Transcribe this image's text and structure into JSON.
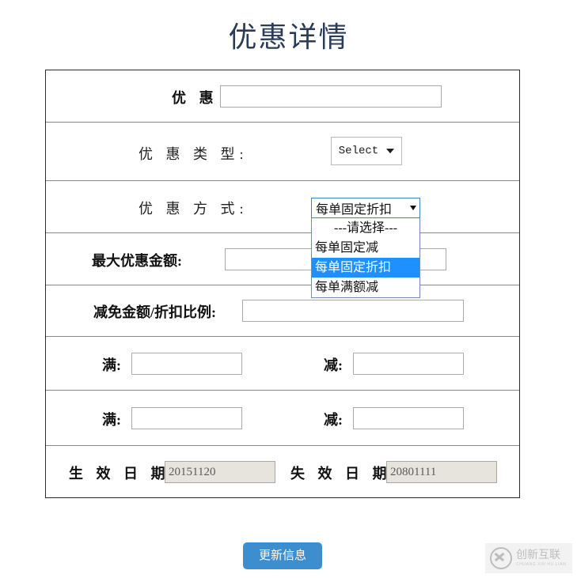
{
  "page": {
    "title": "优惠详情"
  },
  "form": {
    "rows": [
      {
        "label": "优 惠 名 称:",
        "input_value": "",
        "placeholder": ""
      },
      {
        "label": "优 惠 类 型:",
        "select_value": "Select"
      },
      {
        "label": "优 惠 方 式:",
        "select_value": "每单固定折扣",
        "options": [
          "---请选择---",
          "每单固定减",
          "每单固定折扣",
          "每单满额减"
        ],
        "selected_option": "每单固定折扣"
      },
      {
        "label": "最大优惠金额:",
        "input_value": "",
        "placeholder": ""
      },
      {
        "label": "减免金额/折扣比例:",
        "input_value": "",
        "placeholder": ""
      },
      {
        "label_left": "满:",
        "value_left": "",
        "label_right": "减:",
        "value_right": ""
      },
      {
        "label_left": "满:",
        "value_left": "",
        "label_right": "减:",
        "value_right": ""
      },
      {
        "label_left": "生 效 日 期:",
        "value_left": "20151120",
        "label_right": "失 效 日 期:",
        "value_right": "20801111"
      }
    ]
  },
  "actions": {
    "submit_label": "更新信息"
  },
  "watermark": {
    "cn": "创新互联",
    "en": "CHUANG XIN HU LIAN",
    "icon": "circle-x-logo-icon"
  },
  "colors": {
    "accent": "#3d8ecf",
    "select_highlight": "#1e90ff",
    "title": "#2b3a55",
    "table_border": "#2a2a2a",
    "row_divider": "#888888",
    "disabled_field_bg": "#e6e4dd"
  }
}
